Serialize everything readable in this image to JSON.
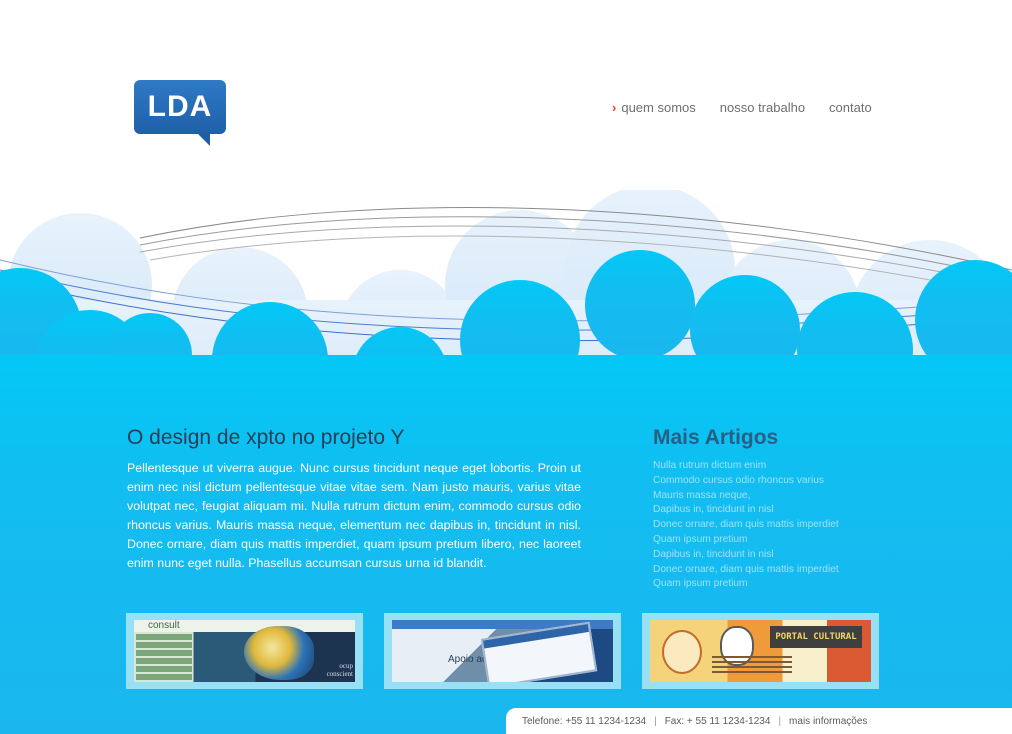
{
  "logo": {
    "text": "LDA"
  },
  "nav": {
    "items": [
      {
        "label": "quem somos",
        "active": true
      },
      {
        "label": "nosso trabalho",
        "active": false
      },
      {
        "label": "contato",
        "active": false
      }
    ]
  },
  "article": {
    "title": "O design de xpto no projeto Y",
    "body": "Pellentesque ut viverra augue. Nunc cursus tincidunt neque eget lobortis. Proin ut enim nec nisl dictum pellentesque vitae vitae sem. Nam justo mauris, varius vitae volutpat nec, feugiat aliquam mi. Nulla rutrum dictum enim, commodo cursus odio rhoncus varius. Mauris massa neque, elementum nec dapibus in, tincidunt in nisl. Donec ornare, diam quis mattis imperdiet, quam ipsum pretium libero, nec laoreet enim nunc eget nulla. Phasellus accumsan cursus urna id blandit."
  },
  "sidebar": {
    "title": "Mais Artigos",
    "items": [
      "Nulla rutrum dictum enim",
      "Commodo cursus odio rhoncus varius",
      "Mauris massa neque,",
      "Dapibus in, tincidunt in nisl",
      "Donec ornare, diam quis mattis imperdiet",
      "Quam ipsum pretium",
      "Dapibus in, tincidunt in nisl",
      "Donec ornare, diam quis mattis imperdiet",
      "Quam ipsum pretium"
    ]
  },
  "thumbs": {
    "t1_head": "consult",
    "t1_caption_1": "ocup",
    "t1_caption_2": "conscient",
    "t2_text": "Apoio ao",
    "t3_banner": "PORTAL CULTURAL"
  },
  "footer": {
    "phone": "Telefone: +55 11 1234-1234",
    "fax": "Fax: + 55 11 1234-1234",
    "more": "mais informações",
    "separator": "|"
  },
  "colors": {
    "sky": "#18baf0",
    "cloud_light": "#dceefb",
    "accent": "#e8421a",
    "title_dark": "#2a3e55"
  }
}
